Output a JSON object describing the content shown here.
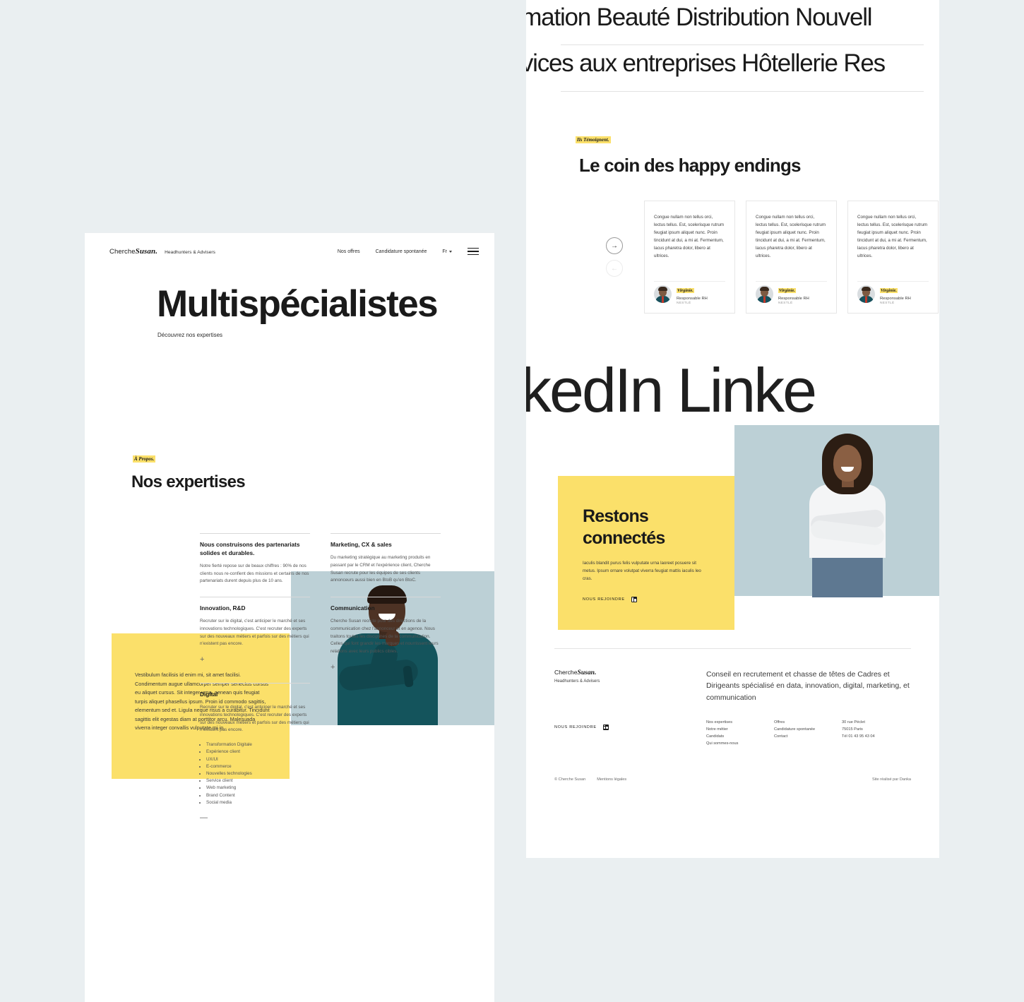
{
  "left_page": {
    "header": {
      "logo_pre": "Cherche",
      "logo_italic": "Susan.",
      "tagline": "Headhunters & Advisers",
      "nav": [
        {
          "label": "Nos offres"
        },
        {
          "label": "Candidature spontanée"
        }
      ],
      "lang": "Fr"
    },
    "hero": {
      "title": "Multispécialistes",
      "subtitle": "Découvrez nos expertises",
      "yellow_paragraph": "Vestibulum facilisis id enim mi, sit amet facilisi. Condimentum augue ullamcorper semper senectus cursus eu aliquet cursus. Sit integer urna, aenean quis feugiat turpis aliquet phasellus ipsum. Proin id commodo sagittis, elementum sed et. Ligula neque risus a curabitur. Tincidunt sagittis elit egestas diam at porttitor arcu. Malesuada viverra integer convallis vulputate mi in."
    },
    "expertise_section": {
      "eyebrow": "À Propos.",
      "title": "Nos expertises",
      "cards": [
        {
          "heading": "Nous construisons des partenariats solides et durables.",
          "body": "Notre fierté repose sur de beaux chiffres : 90% de nos clients nous re-confient des missions et certains de nos partenariats durent depuis plus de 10 ans.",
          "toggle": ""
        },
        {
          "heading": "Marketing, CX & sales",
          "body": "Du marketing stratégique au marketing produits en passant par le CRM et l'expérience client, Cherche Susan recrute pour les équipes de ses clients annonceurs aussi bien en BtoB qu'en BtoC.",
          "toggle": ""
        },
        {
          "heading": "Innovation, R&D",
          "body": "Recruter sur le digital, c'est anticiper le marché et ses innovations technologiques. C'est recruter des experts sur des nouveaux métiers et parfois sur des métiers qui n'existent pas encore.",
          "toggle": "+"
        },
        {
          "heading": "Communication",
          "body": "Cherche Susan recrute pour des directions de la communication chez l'annonceur et en agence. Nous traitons toutes les disciplines de la communication. Celles qui font grandir les marques et nourrissent leurs relations avec leurs publics cibles.",
          "toggle": "+"
        },
        {
          "heading": "Digital",
          "body": "Recruter sur le digital, c'est anticiper le marché et ses innovations technologiques. C'est recruter des experts sur des nouveaux métiers et parfois sur des métiers qui n'existent pas encore.",
          "toggle": "—",
          "list": [
            "Transformation Digitale",
            "Expérience client",
            "UX/UI",
            "E-commerce",
            "Nouvelles technologies",
            "Service client",
            "Web marketing",
            "Brand Content",
            "Social media"
          ]
        }
      ]
    }
  },
  "right_page": {
    "marquee_top": {
      "line1": "ommation  Beauté  Distribution  Nouvell",
      "line2": "Services aux entreprises  Hôtellerie  Res"
    },
    "testimonials": {
      "eyebrow": "Ils Témoignent.",
      "title": "Le coin des happy endings",
      "next_arrow": "→",
      "prev_arrow": "←",
      "cards": [
        {
          "quote": "Congue nullam non tellus orci, lectus tellus. Est, scelerisque rutrum feugiat ipsum aliquet nunc. Proin tincidunt at dui, a mi at. Fermentum, lacus pharetra dolor, libero at ultrices.",
          "name": "Virginie.",
          "role": "Responsable RH",
          "company": "NESTLÉ"
        },
        {
          "quote": "Congue nullam non tellus orci, lectus tellus. Est, scelerisque rutrum feugiat ipsum aliquet nunc. Proin tincidunt at dui, a mi at. Fermentum, lacus pharetra dolor, libero at ultrices.",
          "name": "Virginie.",
          "role": "Responsable RH",
          "company": "NESTLÉ"
        },
        {
          "quote": "Congue nullam non tellus orci, lectus tellus. Est, scelerisque rutrum feugiat ipsum aliquet nunc. Proin tincidunt at dui, a mi at. Fermentum, lacus pharetra dolor, libero at ultrices.",
          "name": "Virginie.",
          "role": "Responsable RH",
          "company": "NESTLÉ"
        }
      ]
    },
    "marquee_mid": "kedIn Linke",
    "connect": {
      "title": "Restons connectés",
      "body": "Iaculis blandit purus felis vulputate urna laoreet posuere sit metus. Ipsum ornare volutpat viverra feugiat mattis iaculis leo cras.",
      "cta": "NOUS REJOINDRE"
    },
    "footer": {
      "logo_pre": "Cherche",
      "logo_italic": "Susan.",
      "tagline": "Headhunters & Advisers",
      "cta": "NOUS REJOINDRE",
      "description": "Conseil en recrutement et chasse de têtes de Cadres et Dirigeants spécialisé en data, innovation, digital, marketing, et communication",
      "col1": [
        "Nos expertises",
        "Notre métier",
        "Candidats",
        "Qui sommes-nous"
      ],
      "col2": [
        "Offres",
        "Candidature spontanée",
        "Contact"
      ],
      "col3": [
        "30 rue Péclet",
        "75015 Paris",
        "Tél 01 43 95 43 04"
      ],
      "copyright": "© Cherche Susan",
      "legal": "Mentions légales",
      "credit": "Site réalisé par Danka"
    }
  },
  "colors": {
    "yellow": "#fbe06a",
    "teal": "#bcd0d6",
    "page_bg": "#eaeff1",
    "text": "#1a1a1a"
  }
}
